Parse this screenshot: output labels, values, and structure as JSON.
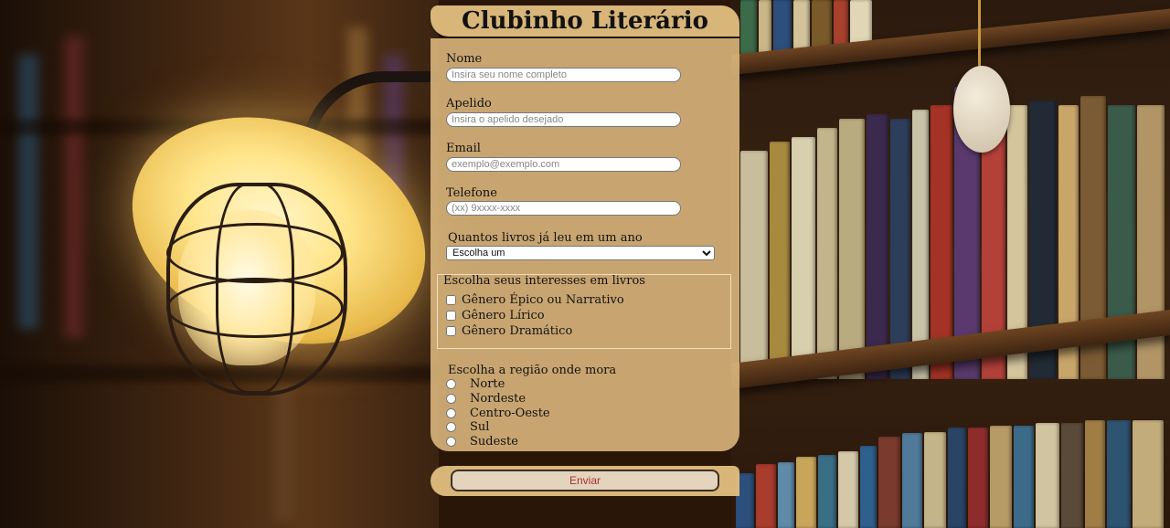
{
  "form": {
    "title": "Clubinho Literário",
    "fields": [
      {
        "label": "Nome",
        "placeholder": "Insira seu nome completo"
      },
      {
        "label": "Apelido",
        "placeholder": "Insira o apelido desejado"
      },
      {
        "label": "Email",
        "placeholder": "exemplo@exemplo.com"
      },
      {
        "label": "Telefone",
        "placeholder": "(xx) 9xxxx-xxxx"
      }
    ],
    "books_question": {
      "label": "Quantos livros já leu em um ano",
      "selected": "Escolha um"
    },
    "interests": {
      "legend": "Escolha seus interesses em livros",
      "options": [
        "Gênero Épico ou Narrativo",
        "Gênero Lírico",
        "Gênero Dramático"
      ]
    },
    "region": {
      "label": "Escolha a região onde mora",
      "options": [
        "Norte",
        "Nordeste",
        "Centro-Oeste",
        "Sul",
        "Sudeste"
      ]
    },
    "submit_label": "Enviar"
  },
  "colors": {
    "panel": "#deba7e",
    "submit_text": "#a83232"
  }
}
